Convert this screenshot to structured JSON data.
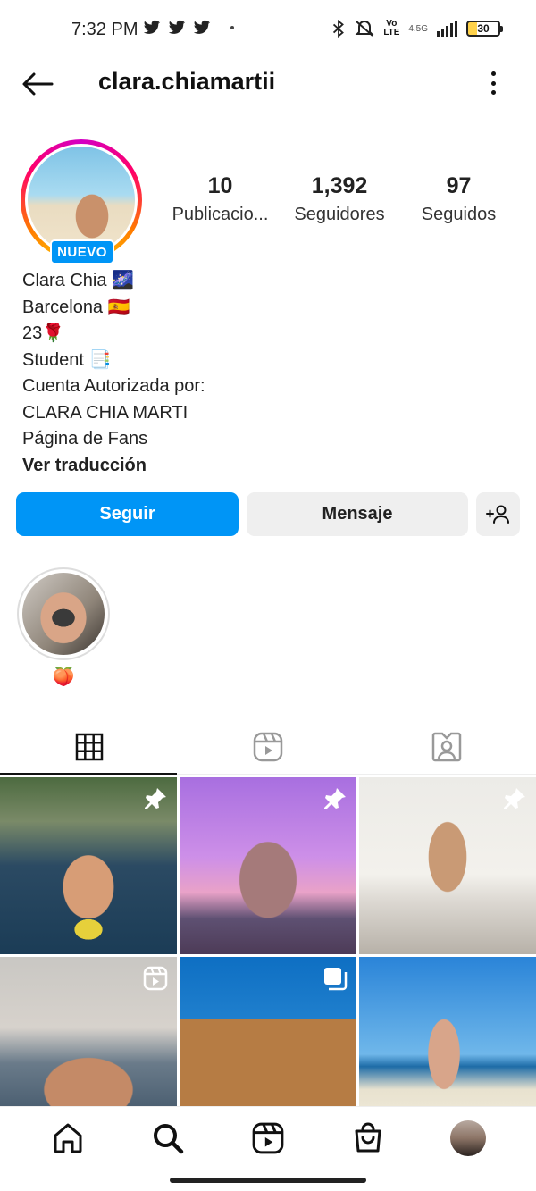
{
  "status_bar": {
    "time": "7:32 PM",
    "network_type": "4.5G",
    "volte": "Vo LTE",
    "battery": "30"
  },
  "header": {
    "username": "clara.chiamartii"
  },
  "profile": {
    "badge": "NUEVO",
    "stats": [
      {
        "value": "10",
        "label": "Publicacio..."
      },
      {
        "value": "1,392",
        "label": "Seguidores"
      },
      {
        "value": "97",
        "label": "Seguidos"
      }
    ],
    "bio_lines": [
      "Clara Chia 🌌",
      "Barcelona 🇪🇸",
      "23🌹",
      "Student 📑",
      "Cuenta Autorizada por:",
      "CLARA CHIA MARTI",
      "Página de Fans"
    ],
    "translate_link": "Ver traducción"
  },
  "actions": {
    "follow_label": "Seguir",
    "message_label": "Mensaje"
  },
  "highlights": [
    {
      "label": "🍑"
    }
  ],
  "tabs": [
    "grid-icon",
    "reels-icon",
    "tagged-icon"
  ],
  "posts": [
    {
      "overlay_icon": "pin-icon"
    },
    {
      "overlay_icon": "pin-icon"
    },
    {
      "overlay_icon": "pin-icon"
    },
    {
      "overlay_icon": "reel-icon"
    },
    {
      "overlay_icon": "carousel-icon"
    },
    {
      "overlay_icon": ""
    }
  ],
  "bottom_nav": [
    "home-icon",
    "search-icon",
    "reels-icon",
    "shop-icon",
    "profile-avatar"
  ],
  "colors": {
    "accent": "#0095f6",
    "secondary_button": "#efefef"
  }
}
